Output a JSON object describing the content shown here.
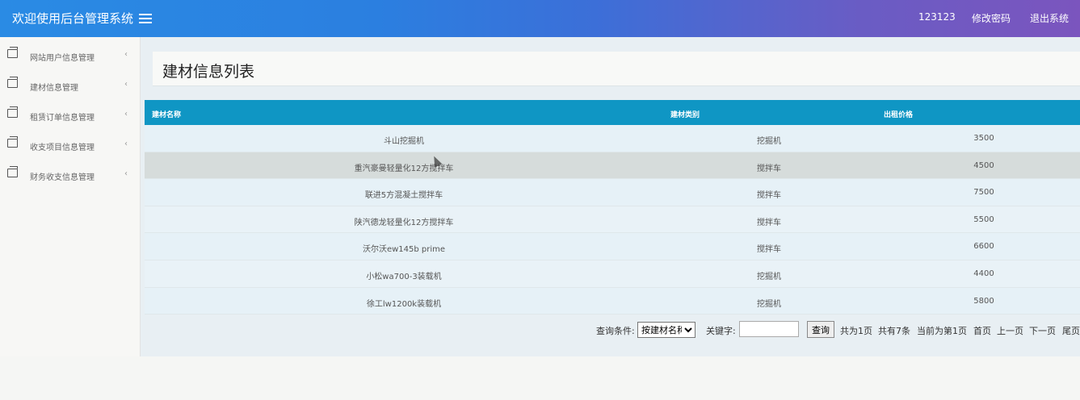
{
  "header": {
    "title": "欢迎使用后台管理系统",
    "username": "123123",
    "change_password": "修改密码",
    "logout": "退出系统"
  },
  "sidebar": {
    "items": [
      {
        "label": "网站用户信息管理",
        "icon": "window-icon"
      },
      {
        "label": "建材信息管理",
        "icon": "window-icon"
      },
      {
        "label": "租赁订单信息管理",
        "icon": "window-icon"
      },
      {
        "label": "收支项目信息管理",
        "icon": "window-icon"
      },
      {
        "label": "财务收支信息管理",
        "icon": "window-icon"
      }
    ],
    "arrow": "‹"
  },
  "main": {
    "title": "建材信息列表",
    "table": {
      "headers": [
        "建材名称",
        "建材类别",
        "出租价格"
      ],
      "rows": [
        [
          "斗山挖掘机",
          "挖掘机",
          "3500"
        ],
        [
          "重汽豪曼轻量化12方搅拌车",
          "搅拌车",
          "4500"
        ],
        [
          "联进5方混凝土搅拌车",
          "搅拌车",
          "7500"
        ],
        [
          "陕汽德龙轻量化12方搅拌车",
          "搅拌车",
          "5500"
        ],
        [
          "沃尔沃ew145b prime",
          "搅拌车",
          "6600"
        ],
        [
          "小松wa700-3装载机",
          "挖掘机",
          "4400"
        ],
        [
          "徐工lw1200k装载机",
          "挖掘机",
          "5800"
        ]
      ]
    },
    "pager": {
      "condition_label": "查询条件:",
      "condition_value": "按建材名称",
      "keyword_label": "关键字:",
      "keyword_value": "",
      "search_button": "查询",
      "total_pages": "共为1页",
      "total_items": "共有7条",
      "current_page": "当前为第1页",
      "first": "首页",
      "prev": "上一页",
      "next": "下一页",
      "last": "尾页"
    }
  },
  "colors": {
    "header_gradient_start": "#2a8be4",
    "header_gradient_end": "#7b55be",
    "table_header": "#0f96c4",
    "highlight_row": "#d6dcdb"
  }
}
